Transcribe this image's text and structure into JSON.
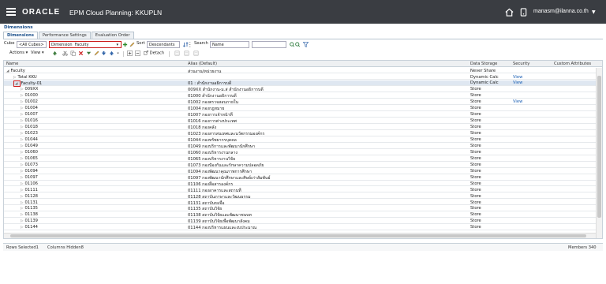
{
  "topbar": {
    "logo": "ORACLE",
    "title": "EPM Cloud Planning: KKUPLN",
    "user": "manasm@ilanna.co.th"
  },
  "page": {
    "title": "Dimensions"
  },
  "tabs": [
    {
      "label": "Dimensions"
    },
    {
      "label": "Performance Settings"
    },
    {
      "label": "Evaluation Order"
    }
  ],
  "toolbar": {
    "cube_label": "Cube",
    "cube_value": "<All Cubes>",
    "dimension_label": "Dimension",
    "dimension_value": "Faculty",
    "sort_label": "Sort",
    "sort_value": "Descendants",
    "search_label": "Search",
    "search_value": "Name",
    "actions_label": "Actions",
    "view_label": "View",
    "detach_label": "Detach"
  },
  "grid": {
    "columns": [
      "Name",
      "Alias (Default)",
      "Data Storage",
      "Security",
      "Custom Attributes"
    ],
    "rows": [
      {
        "name": "Faculty",
        "alias": "ส่วนงาน/หน่วยงาน",
        "ds": "Never Share",
        "sec": "",
        "level": 0,
        "expanded": true
      },
      {
        "name": "Total KKU",
        "alias": "",
        "ds": "Dynamic Calc",
        "sec": "View",
        "level": 1,
        "expanded": false
      },
      {
        "name": "Faculty-01",
        "alias": "01 : สำนักงานอธิการบดี",
        "ds": "Dynamic Calc",
        "sec": "View",
        "level": 1,
        "expanded": true,
        "boxed": true
      },
      {
        "name": "009XX",
        "alias": "009XX สำนักงาน-ม.ส่ สำนักงานอธิการบดี",
        "ds": "Store",
        "sec": "",
        "level": 2
      },
      {
        "name": "01000",
        "alias": "01000 สำนักงานอธิการบดี",
        "ds": "Store",
        "sec": "",
        "level": 2
      },
      {
        "name": "01002",
        "alias": "01002 กองตรวจสอบภายใน",
        "ds": "Store",
        "sec": "View",
        "level": 2
      },
      {
        "name": "01004",
        "alias": "01004 กองกฎหมาย",
        "ds": "Store",
        "sec": "",
        "level": 2
      },
      {
        "name": "01007",
        "alias": "01007 กองการเจ้าหน้าที่",
        "ds": "Store",
        "sec": "",
        "level": 2
      },
      {
        "name": "01016",
        "alias": "01016 กองการต่างประเทศ",
        "ds": "Store",
        "sec": "",
        "level": 2
      },
      {
        "name": "01018",
        "alias": "01018 กองคลัง",
        "ds": "Store",
        "sec": "",
        "level": 2
      },
      {
        "name": "01023",
        "alias": "01023 กองสารสนเทศและนวัตกรรมองค์กร",
        "ds": "Store",
        "sec": "",
        "level": 2
      },
      {
        "name": "01044",
        "alias": "01044 กองทรัพยากรบุคคล",
        "ds": "Store",
        "sec": "",
        "level": 2
      },
      {
        "name": "01049",
        "alias": "01049 กองบริการและพัฒนานักศึกษา",
        "ds": "Store",
        "sec": "",
        "level": 2
      },
      {
        "name": "01060",
        "alias": "01060 กองบริหารงานกลาง",
        "ds": "Store",
        "sec": "",
        "level": 2
      },
      {
        "name": "01065",
        "alias": "01065 กองบริหารงานวิจัย",
        "ds": "Store",
        "sec": "",
        "level": 2
      },
      {
        "name": "01073",
        "alias": "01073 กองป้องกันและรักษาความปลอดภัย",
        "ds": "Store",
        "sec": "",
        "level": 2
      },
      {
        "name": "01094",
        "alias": "01094 กองพัฒนาคุณภาพการศึกษา",
        "ds": "Store",
        "sec": "",
        "level": 2
      },
      {
        "name": "01097",
        "alias": "01097 กองพัฒนานักศึกษาและศิษย์เก่าสัมพันธ์",
        "ds": "Store",
        "sec": "",
        "level": 2
      },
      {
        "name": "01106",
        "alias": "01106 กองสื่อสารองค์กร",
        "ds": "Store",
        "sec": "",
        "level": 2
      },
      {
        "name": "01111",
        "alias": "01111 กองอาคารและสถานที่",
        "ds": "Store",
        "sec": "",
        "level": 2
      },
      {
        "name": "01128",
        "alias": "01128 สถาบันภาษาและวัฒนธรรม",
        "ds": "Store",
        "sec": "",
        "level": 2
      },
      {
        "name": "01131",
        "alias": "01131 สถาบันขงจื่อ",
        "ds": "Store",
        "sec": "",
        "level": 2
      },
      {
        "name": "01135",
        "alias": "01135 สถาบันวิจัย",
        "ds": "Store",
        "sec": "",
        "level": 2
      },
      {
        "name": "01138",
        "alias": "01138 สถาบันวิจัยและพัฒนาชนบท",
        "ds": "Store",
        "sec": "",
        "level": 2
      },
      {
        "name": "01139",
        "alias": "01139 สถาบันวิจัยเพื่อพัฒนาสังคม",
        "ds": "Store",
        "sec": "",
        "level": 2
      },
      {
        "name": "01144",
        "alias": "01144 กองบริหารแผนและงบประมาณ",
        "ds": "Store",
        "sec": "",
        "level": 2
      }
    ]
  },
  "status": {
    "rows_selected": "Rows Selected1",
    "columns_hidden": "Columns Hidden8",
    "members": "Members 340"
  }
}
